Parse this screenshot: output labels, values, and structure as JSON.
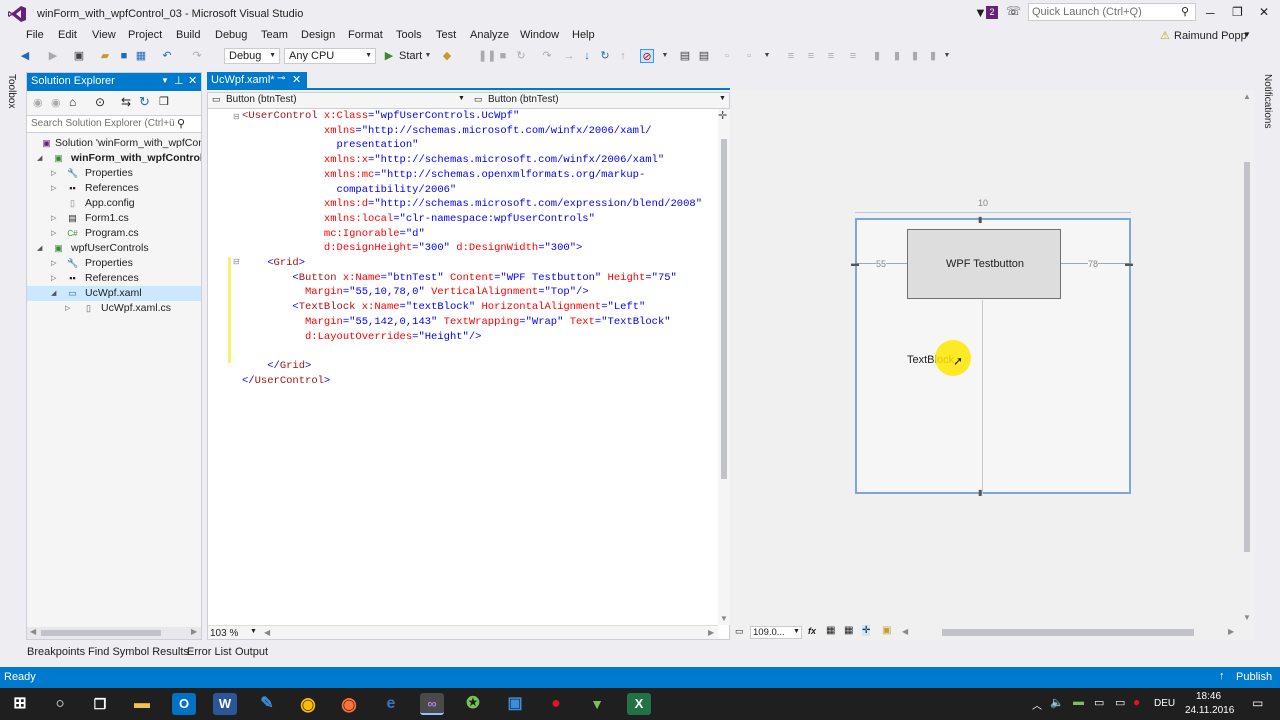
{
  "window": {
    "title": "winForm_with_wpfControl_03 - Microsoft Visual Studio",
    "notif_count": "2",
    "quick_launch": "Quick Launch (Ctrl+Q)",
    "user": "Raimund Popp"
  },
  "menu": [
    "File",
    "Edit",
    "View",
    "Project",
    "Build",
    "Debug",
    "Team",
    "Design",
    "Format",
    "Tools",
    "Test",
    "Analyze",
    "Window",
    "Help"
  ],
  "toolbar": {
    "config": "Debug",
    "platform": "Any CPU",
    "start": "Start"
  },
  "side_tabs": {
    "toolbox": "Toolbox",
    "notifications": "Notifications"
  },
  "solution_explorer": {
    "title": "Solution Explorer",
    "search_placeholder": "Search Solution Explorer (Ctrl+ü",
    "items": [
      {
        "label": "Solution 'winForm_with_wpfContr",
        "bold": false
      },
      {
        "label": "winForm_with_wpfControl_0",
        "bold": true
      },
      {
        "label": "Properties",
        "bold": false
      },
      {
        "label": "References",
        "bold": false
      },
      {
        "label": "App.config",
        "bold": false
      },
      {
        "label": "Form1.cs",
        "bold": false
      },
      {
        "label": "Program.cs",
        "bold": false
      },
      {
        "label": "wpfUserControls",
        "bold": false
      },
      {
        "label": "Properties",
        "bold": false
      },
      {
        "label": "References",
        "bold": false
      },
      {
        "label": "UcWpf.xaml",
        "bold": false
      },
      {
        "label": "UcWpf.xaml.cs",
        "bold": false
      }
    ]
  },
  "editor": {
    "tab": "UcWpf.xaml*",
    "nav_left": "Button (btnTest)",
    "nav_right": "Button (btnTest)",
    "zoom": "103 %",
    "lines": [
      [
        [
          "t",
          "<"
        ],
        [
          "t",
          "UserControl"
        ],
        [
          "a",
          " x:Class"
        ],
        [
          "p",
          "="
        ],
        [
          "v",
          "\"wpfUserControls.UcWpf\""
        ]
      ],
      [
        [
          "a",
          "             xmlns"
        ],
        [
          "p",
          "="
        ],
        [
          "v",
          "\"http://schemas.microsoft.com/winfx/2006/xaml/"
        ]
      ],
      [
        [
          "v",
          "               presentation\""
        ]
      ],
      [
        [
          "a",
          "             xmlns:x"
        ],
        [
          "p",
          "="
        ],
        [
          "v",
          "\"http://schemas.microsoft.com/winfx/2006/xaml\""
        ]
      ],
      [
        [
          "a",
          "             xmlns:mc"
        ],
        [
          "p",
          "="
        ],
        [
          "v",
          "\"http://schemas.openxmlformats.org/markup-"
        ]
      ],
      [
        [
          "v",
          "               compatibility/2006\""
        ]
      ],
      [
        [
          "a",
          "             xmlns:d"
        ],
        [
          "p",
          "="
        ],
        [
          "v",
          "\"http://schemas.microsoft.com/expression/blend/2008\""
        ]
      ],
      [
        [
          "a",
          "             xmlns:local"
        ],
        [
          "p",
          "="
        ],
        [
          "v",
          "\"clr-namespace:wpfUserControls\""
        ]
      ],
      [
        [
          "a",
          "             mc:Ignorable"
        ],
        [
          "p",
          "="
        ],
        [
          "v",
          "\"d\""
        ]
      ],
      [
        [
          "a",
          "             d:DesignHeight"
        ],
        [
          "p",
          "="
        ],
        [
          "v",
          "\"300\""
        ],
        [
          "a",
          " d:DesignWidth"
        ],
        [
          "p",
          "="
        ],
        [
          "v",
          "\"300\""
        ],
        [
          "p",
          ">"
        ]
      ],
      [
        [
          "p",
          "    <"
        ],
        [
          "t",
          "Grid"
        ],
        [
          "p",
          ">"
        ]
      ],
      [
        [
          "p",
          "        <"
        ],
        [
          "t",
          "Button"
        ],
        [
          "a",
          " x:Name"
        ],
        [
          "p",
          "="
        ],
        [
          "v",
          "\"btnTest\""
        ],
        [
          "a",
          " Content"
        ],
        [
          "p",
          "="
        ],
        [
          "v",
          "\"WPF Testbutton\""
        ],
        [
          "a",
          " Height"
        ],
        [
          "p",
          "="
        ],
        [
          "v",
          "\"75\""
        ]
      ],
      [
        [
          "a",
          "          Margin"
        ],
        [
          "p",
          "="
        ],
        [
          "v",
          "\"55,10,78,0\""
        ],
        [
          "a",
          " VerticalAlignment"
        ],
        [
          "p",
          "="
        ],
        [
          "v",
          "\"Top\""
        ],
        [
          "p",
          "/>"
        ]
      ],
      [
        [
          "p",
          "        <"
        ],
        [
          "t",
          "TextBlock"
        ],
        [
          "a",
          " x:Name"
        ],
        [
          "p",
          "="
        ],
        [
          "v",
          "\"textBlock\""
        ],
        [
          "a",
          " HorizontalAlignment"
        ],
        [
          "p",
          "="
        ],
        [
          "v",
          "\"Left\""
        ]
      ],
      [
        [
          "a",
          "          Margin"
        ],
        [
          "p",
          "="
        ],
        [
          "v",
          "\"55,142,0,143\""
        ],
        [
          "a",
          " TextWrapping"
        ],
        [
          "p",
          "="
        ],
        [
          "v",
          "\"Wrap\""
        ],
        [
          "a",
          " Text"
        ],
        [
          "p",
          "="
        ],
        [
          "v",
          "\"TextBlock\""
        ]
      ],
      [
        [
          "a",
          "          d:LayoutOverrides"
        ],
        [
          "p",
          "="
        ],
        [
          "v",
          "\"Height\""
        ],
        [
          "p",
          "/>"
        ]
      ],
      [
        [
          "p",
          ""
        ]
      ],
      [
        [
          "p",
          "    </"
        ],
        [
          "t",
          "Grid"
        ],
        [
          "p",
          ">"
        ]
      ],
      [
        [
          "p",
          "</"
        ],
        [
          "t",
          "UserControl"
        ],
        [
          "p",
          ">"
        ]
      ]
    ]
  },
  "designer": {
    "button_label": "WPF Testbutton",
    "textblock_label": "TextBlock",
    "margin_left": "55",
    "margin_right": "78",
    "margin_top": "10",
    "zoom": "109.0..."
  },
  "bottom_tabs": [
    "Breakpoints",
    "Find Symbol Results",
    "Error List",
    "Output"
  ],
  "status": {
    "left": "Ready",
    "right": "Publish"
  },
  "taskbar": {
    "lang": "DEU",
    "time": "18:46",
    "date": "24.11.2016"
  },
  "colors": {
    "accent": "#007acc",
    "vs_purple": "#68217a"
  }
}
